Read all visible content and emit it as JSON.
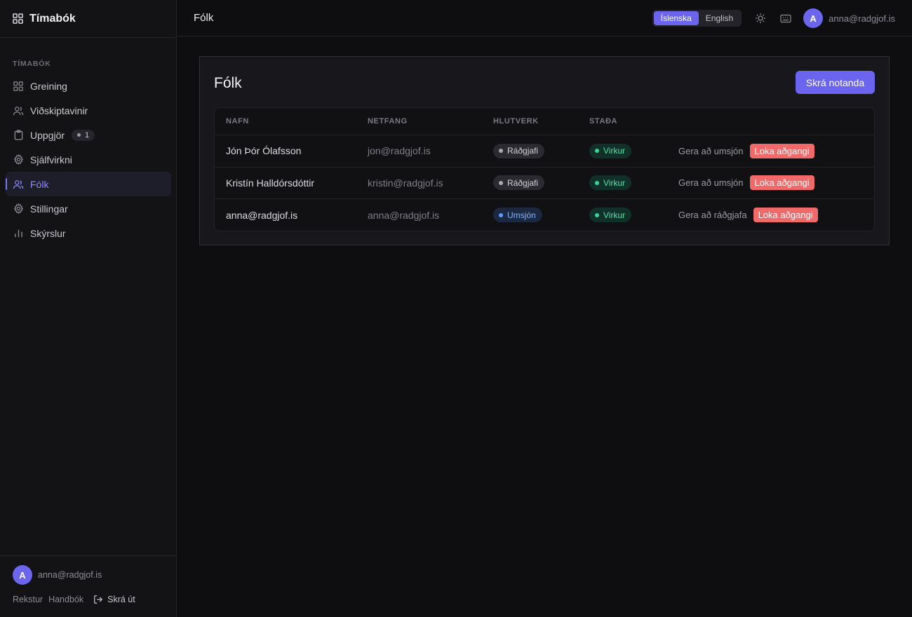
{
  "app": {
    "name": "Tímabók"
  },
  "sidebar": {
    "section_label": "TÍMABÓK",
    "items": [
      {
        "label": "Greining",
        "icon": "grid-icon"
      },
      {
        "label": "Viðskiptavinir",
        "icon": "users-icon"
      },
      {
        "label": "Uppgjör",
        "icon": "clipboard-icon",
        "badge": "1"
      },
      {
        "label": "Sjálfvirkni",
        "icon": "gear-icon"
      },
      {
        "label": "Fólk",
        "icon": "users-icon",
        "active": true
      },
      {
        "label": "Stillingar",
        "icon": "gear-icon"
      },
      {
        "label": "Skýrslur",
        "icon": "bar-chart-icon"
      }
    ],
    "user": {
      "initial": "A",
      "email": "anna@radgjof.is"
    },
    "links": {
      "rekstur": "Rekstur",
      "handbok": "Handbók",
      "logout": "Skrá út"
    }
  },
  "topbar": {
    "title": "Fólk",
    "lang": {
      "is": "Íslenska",
      "en": "English",
      "selected": "is"
    },
    "user": {
      "initial": "A",
      "email": "anna@radgjof.is"
    }
  },
  "card": {
    "title": "Fólk",
    "add_button": "Skrá notanda",
    "columns": [
      "NAFN",
      "NETFANG",
      "HLUTVERK",
      "STAÐA"
    ],
    "rows": [
      {
        "name": "Jón Þór Ólafsson",
        "email": "jon@radgjof.is",
        "role": "Ráðgjafi",
        "status": "Virkur",
        "action": "Gera að umsjón",
        "danger": "Loka aðgangi"
      },
      {
        "name": "Kristín Halldórsdóttir",
        "email": "kristin@radgjof.is",
        "role": "Ráðgjafi",
        "status": "Virkur",
        "action": "Gera að umsjón",
        "danger": "Loka aðgangi"
      },
      {
        "name": "anna@radgjof.is",
        "email": "anna@radgjof.is",
        "role": "Umsjón",
        "status": "Virkur",
        "action": "Gera að ráðgjafa",
        "danger": "Loka aðgangi"
      }
    ]
  },
  "colors": {
    "accent": "#6a64ef",
    "danger": "#f06a6a",
    "success": "#3ad39a",
    "background": "#0e0e10"
  }
}
